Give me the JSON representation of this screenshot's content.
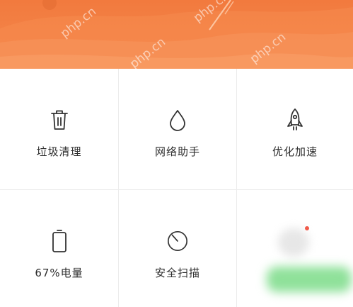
{
  "banner": {
    "watermarks": [
      "php.cn",
      "php.cn",
      "php.cn",
      "php.cn"
    ],
    "color": "#f27a3e"
  },
  "tiles": [
    {
      "label": "垃圾清理",
      "icon": "trash-icon"
    },
    {
      "label": "网络助手",
      "icon": "droplet-icon"
    },
    {
      "label": "优化加速",
      "icon": "rocket-icon"
    },
    {
      "label": "67%电量",
      "icon": "battery-icon"
    },
    {
      "label": "安全扫描",
      "icon": "scan-dial-icon"
    },
    {
      "label": "",
      "icon": "blurred-icon"
    }
  ],
  "colors": {
    "accent": "#f27a3e",
    "icon_stroke": "#333333",
    "text": "#2d2d2d",
    "divider": "#ececec",
    "notification_dot": "#f05a4a",
    "blurred_green": "#8fe19a"
  }
}
